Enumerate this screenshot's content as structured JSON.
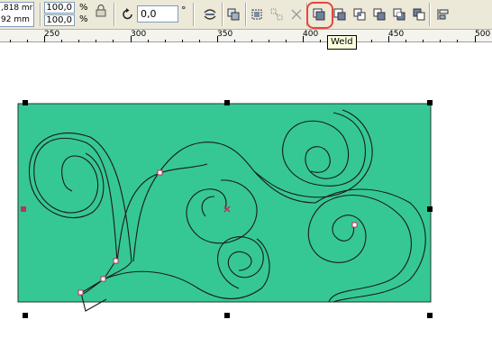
{
  "toolbar": {
    "size_x": ",818 mr",
    "size_y": "92 mm",
    "scale_x": "100,0",
    "scale_y": "100,0",
    "pct_x": "%",
    "pct_y": "%",
    "rotation_value": "0,0",
    "degree_symbol": "°",
    "buttons": [
      {
        "name": "mirror-icon"
      },
      {
        "name": "group-icon"
      },
      {
        "name": "ungroup-icon"
      },
      {
        "name": "ungroup-all-icon"
      },
      {
        "name": "weld-icon"
      },
      {
        "name": "trim-icon"
      },
      {
        "name": "intersect-icon"
      },
      {
        "name": "simplify-icon"
      },
      {
        "name": "front-minus-back-icon"
      },
      {
        "name": "back-minus-front-icon"
      },
      {
        "name": "align-distribute-icon"
      }
    ]
  },
  "tooltip": "Weld",
  "ruler": {
    "ticks": [
      "250",
      "300",
      "350",
      "400",
      "450",
      "500"
    ]
  },
  "colors": {
    "fill": "#35c894",
    "accent": "#d0245a",
    "highlight": "#e8463a"
  }
}
